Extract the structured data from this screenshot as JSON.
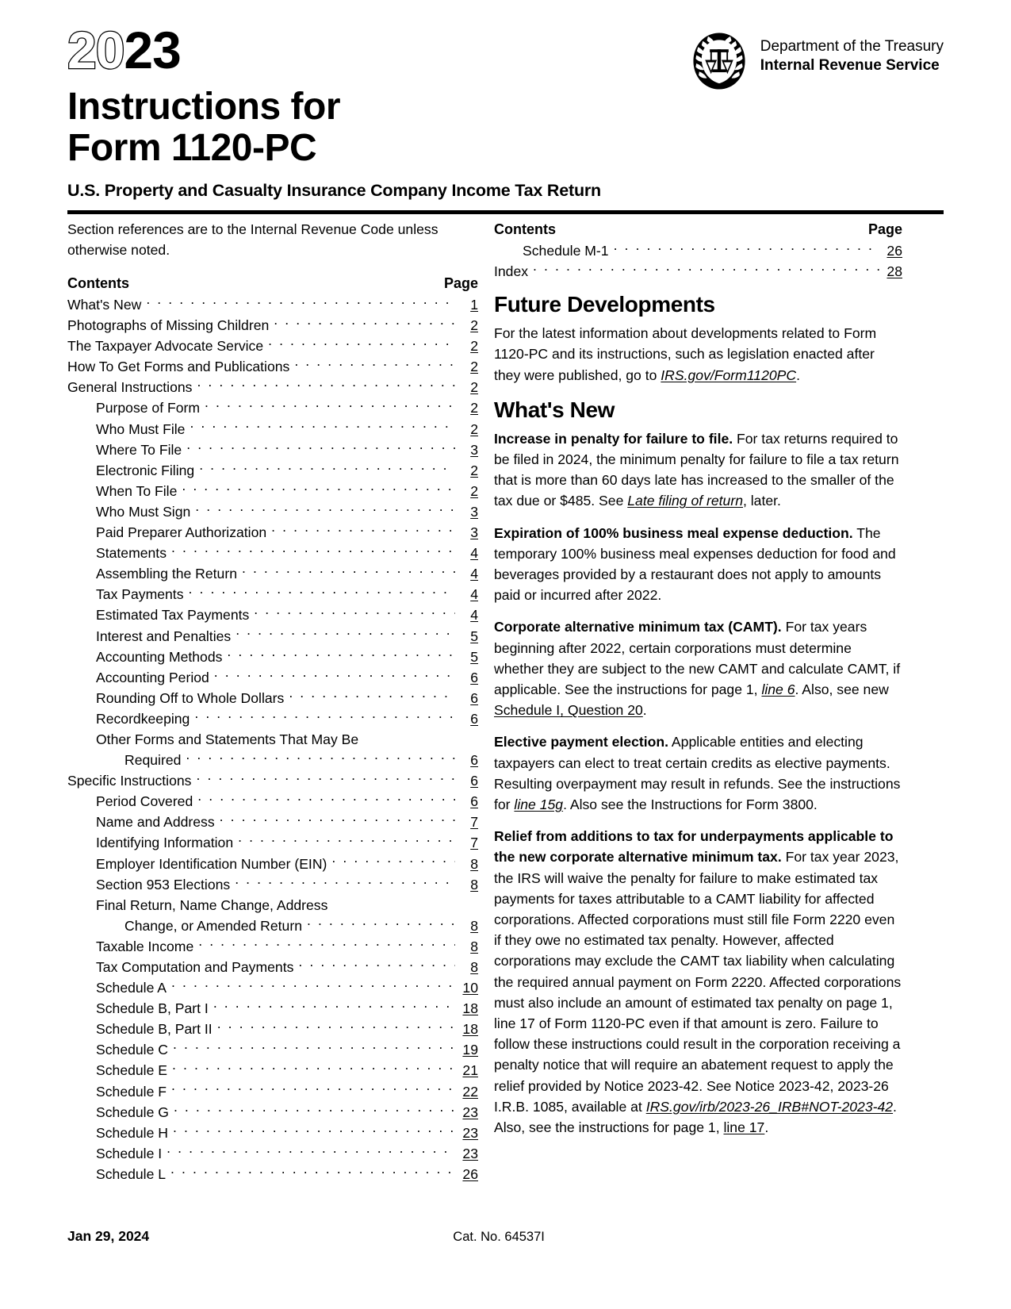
{
  "masthead": {
    "year_hollow": "20",
    "year_solid": "23",
    "title_line1": "Instructions for",
    "title_line2": "Form 1120-PC",
    "subtitle": "U.S. Property and Casualty Insurance Company Income Tax Return"
  },
  "agency": {
    "seal_icon": "irs-eagle-scales-seal",
    "department": "Department of the Treasury",
    "service": "Internal Revenue Service"
  },
  "left_column": {
    "intro": "Section references are to the Internal Revenue Code unless otherwise noted.",
    "toc_header": {
      "contents": "Contents",
      "page": "Page"
    },
    "toc": [
      {
        "label": "What's New",
        "page": "1",
        "indent": 0
      },
      {
        "label": "Photographs of Missing Children",
        "page": "2",
        "indent": 0
      },
      {
        "label": "The Taxpayer Advocate Service",
        "page": "2",
        "indent": 0
      },
      {
        "label": "How To Get Forms and Publications",
        "page": "2",
        "indent": 0
      },
      {
        "label": "General Instructions",
        "page": "2",
        "indent": 0
      },
      {
        "label": "Purpose of Form",
        "page": "2",
        "indent": 1
      },
      {
        "label": "Who Must File",
        "page": "2",
        "indent": 1
      },
      {
        "label": "Where To File",
        "page": "3",
        "indent": 1
      },
      {
        "label": "Electronic Filing",
        "page": "2",
        "indent": 1
      },
      {
        "label": "When To File",
        "page": "2",
        "indent": 1
      },
      {
        "label": "Who Must Sign",
        "page": "3",
        "indent": 1
      },
      {
        "label": "Paid Preparer Authorization",
        "page": "3",
        "indent": 1
      },
      {
        "label": "Statements",
        "page": "4",
        "indent": 1
      },
      {
        "label": "Assembling the Return",
        "page": "4",
        "indent": 1
      },
      {
        "label": "Tax Payments",
        "page": "4",
        "indent": 1
      },
      {
        "label": "Estimated Tax Payments",
        "page": "4",
        "indent": 1
      },
      {
        "label": "Interest and Penalties",
        "page": "5",
        "indent": 1
      },
      {
        "label": "Accounting Methods",
        "page": "5",
        "indent": 1
      },
      {
        "label": "Accounting Period",
        "page": "6",
        "indent": 1
      },
      {
        "label": "Rounding Off to Whole Dollars",
        "page": "6",
        "indent": 1
      },
      {
        "label": "Recordkeeping",
        "page": "6",
        "indent": 1
      },
      {
        "label": "Other Forms and Statements That May Be",
        "page": "",
        "indent": 1,
        "noleader": true
      },
      {
        "label": "Required",
        "page": "6",
        "indent": 2
      },
      {
        "label": "Specific Instructions",
        "page": "6",
        "indent": 0
      },
      {
        "label": "Period Covered",
        "page": "6",
        "indent": 1
      },
      {
        "label": "Name and Address",
        "page": "7",
        "indent": 1
      },
      {
        "label": "Identifying Information",
        "page": "7",
        "indent": 1
      },
      {
        "label": "Employer Identification Number (EIN)",
        "page": "8",
        "indent": 1
      },
      {
        "label": "Section 953 Elections",
        "page": "8",
        "indent": 1
      },
      {
        "label": "Final Return, Name Change, Address",
        "page": "",
        "indent": 1,
        "noleader": true
      },
      {
        "label": "Change, or Amended Return",
        "page": "8",
        "indent": 2
      },
      {
        "label": "Taxable Income",
        "page": "8",
        "indent": 1
      },
      {
        "label": "Tax Computation and Payments",
        "page": "8",
        "indent": 1
      },
      {
        "label": "Schedule A",
        "page": "10",
        "indent": 1
      },
      {
        "label": "Schedule B, Part I",
        "page": "18",
        "indent": 1
      },
      {
        "label": "Schedule B, Part II",
        "page": "18",
        "indent": 1
      },
      {
        "label": "Schedule C",
        "page": "19",
        "indent": 1
      },
      {
        "label": "Schedule E",
        "page": "21",
        "indent": 1
      },
      {
        "label": "Schedule F",
        "page": "22",
        "indent": 1
      },
      {
        "label": "Schedule G",
        "page": "23",
        "indent": 1
      },
      {
        "label": "Schedule H",
        "page": "23",
        "indent": 1
      },
      {
        "label": "Schedule I",
        "page": "23",
        "indent": 1
      },
      {
        "label": "Schedule L",
        "page": "26",
        "indent": 1
      }
    ]
  },
  "right_column": {
    "toc_header": {
      "contents": "Contents",
      "page": "Page"
    },
    "toc": [
      {
        "label": "Schedule M-1",
        "page": "26",
        "indent": 1
      },
      {
        "label": "Index",
        "page": "28",
        "indent": 0
      }
    ],
    "future_developments": {
      "heading": "Future Developments",
      "text_part1": "For the latest information about developments related to Form 1120-PC and its instructions, such as legislation enacted after they were published, go to ",
      "link": "IRS.gov/Form1120PC",
      "text_part2": "."
    },
    "whats_new": {
      "heading": "What's New",
      "items": [
        {
          "run_in": "Increase in penalty for failure to file.",
          "body1": " For tax returns required to be filed in 2024, the minimum penalty for failure to file a tax return that is more than 60 days late has increased to the smaller of the tax due or $485. See ",
          "link1": "Late filing of return",
          "body2": ", later."
        },
        {
          "run_in": "Expiration of 100% business meal expense deduction.",
          "body1": " The temporary 100% business meal expenses deduction for food and beverages provided by a restaurant does not apply to amounts paid or incurred after 2022."
        },
        {
          "run_in": "Corporate alternative minimum tax (CAMT).",
          "body1": " For tax years beginning after 2022, certain corporations must determine whether they are subject to the new CAMT and calculate CAMT, if applicable. See the instructions for page 1, ",
          "link1": "line 6",
          "body2": ". Also, see new ",
          "link2": "Schedule I, Question 20",
          "body3": "."
        },
        {
          "run_in": "Elective payment election.",
          "body1": " Applicable entities and electing taxpayers can elect to treat certain credits as elective payments. Resulting overpayment may result in refunds. See the instructions for ",
          "link1": "line 15g",
          "body2": ". Also see the Instructions for Form 3800."
        },
        {
          "run_in": "Relief from additions to tax for underpayments applicable to the new corporate alternative minimum tax.",
          "body1": " For tax year 2023, the IRS will waive the penalty for failure to make estimated tax payments for taxes attributable to a CAMT liability for affected corporations. Affected corporations must still file Form 2220 even if they owe no estimated tax penalty. However, affected corporations may exclude the CAMT tax liability when calculating the required annual payment on Form 2220. Affected corporations must also include an amount of estimated tax penalty on page 1, line 17 of Form 1120-PC even if that amount is zero. Failure to follow these instructions could result in the corporation receiving a penalty notice that will require an abatement request to apply the relief provided by Notice 2023-42. See Notice 2023-42, 2023-26 I.R.B. 1085, available at ",
          "link1": "IRS.gov/irb/2023-26_IRB#NOT-2023-42",
          "body2": ". Also, see the instructions for page 1, ",
          "link2": "line 17",
          "body3": "."
        }
      ]
    }
  },
  "footer": {
    "date": "Jan 29, 2024",
    "cat_no": "Cat. No. 64537I"
  }
}
